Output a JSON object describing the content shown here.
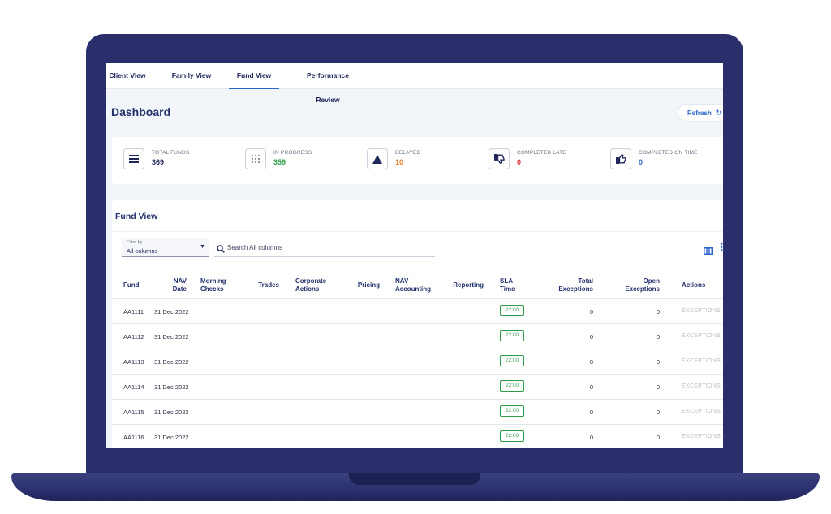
{
  "nav": {
    "tabs": [
      {
        "label": "Client View"
      },
      {
        "label": "Family View"
      },
      {
        "label": "Fund View"
      },
      {
        "label": "Performance Review"
      }
    ],
    "active_tab": "Fund View"
  },
  "header": {
    "title": "Dashboard",
    "refresh_label": "Refresh"
  },
  "stats": [
    {
      "label": "TOTAL FUNDS",
      "value": "369",
      "icon": "list-icon",
      "color": "#20275a"
    },
    {
      "label": "IN PROGRESS",
      "value": "359",
      "icon": "progress-grid-icon",
      "color": "#2e9a47"
    },
    {
      "label": "DELAYED",
      "value": "10",
      "icon": "warning-triangle-icon",
      "color": "#e8822c"
    },
    {
      "label": "COMPLETED LATE",
      "value": "0",
      "icon": "thumbs-down-icon",
      "color": "#d8333a"
    },
    {
      "label": "COMPLETED ON TIME",
      "value": "0",
      "icon": "thumbs-up-icon",
      "color": "#2c68c9"
    }
  ],
  "fund_view": {
    "title": "Fund View",
    "filter": {
      "label": "Filter by",
      "value": "All columns"
    },
    "search": {
      "placeholder": "Search All columns"
    },
    "columns": [
      {
        "l1": "Fund",
        "l2": ""
      },
      {
        "l1": "NAV",
        "l2": "Date"
      },
      {
        "l1": "Morning",
        "l2": "Checks"
      },
      {
        "l1": "Trades",
        "l2": ""
      },
      {
        "l1": "Corporate",
        "l2": "Actions"
      },
      {
        "l1": "Pricing",
        "l2": ""
      },
      {
        "l1": "NAV",
        "l2": "Accounting"
      },
      {
        "l1": "Reporting",
        "l2": ""
      },
      {
        "l1": "SLA",
        "l2": "Time"
      },
      {
        "l1": "Total",
        "l2": "Exceptions"
      },
      {
        "l1": "Open",
        "l2": "Exceptions"
      },
      {
        "l1": "Actions",
        "l2": ""
      }
    ],
    "rows": [
      {
        "fund": "AA1111",
        "nav_date": "31 Dec 2022",
        "sla": "22:00",
        "total": "0",
        "open": "0",
        "action": "EXCEPTIONS"
      },
      {
        "fund": "AA1112",
        "nav_date": "31 Dec 2022",
        "sla": "22:00",
        "total": "0",
        "open": "0",
        "action": "EXCEPTIONS"
      },
      {
        "fund": "AA1113",
        "nav_date": "31 Dec 2022",
        "sla": "22:00",
        "total": "0",
        "open": "0",
        "action": "EXCEPTIONS"
      },
      {
        "fund": "AA1114",
        "nav_date": "31 Dec 2022",
        "sla": "22:00",
        "total": "0",
        "open": "0",
        "action": "EXCEPTIONS"
      },
      {
        "fund": "AA1115",
        "nav_date": "31 Dec 2022",
        "sla": "22:00",
        "total": "0",
        "open": "0",
        "action": "EXCEPTIONS"
      },
      {
        "fund": "AA1116",
        "nav_date": "31 Dec 2022",
        "sla": "22:00",
        "total": "0",
        "open": "0",
        "action": "EXCEPTIONS"
      }
    ]
  },
  "colors": {
    "laptop": "#2a2f6b",
    "accent": "#2c68c9",
    "title": "#22306b",
    "sla_green": "#2e9a47"
  }
}
